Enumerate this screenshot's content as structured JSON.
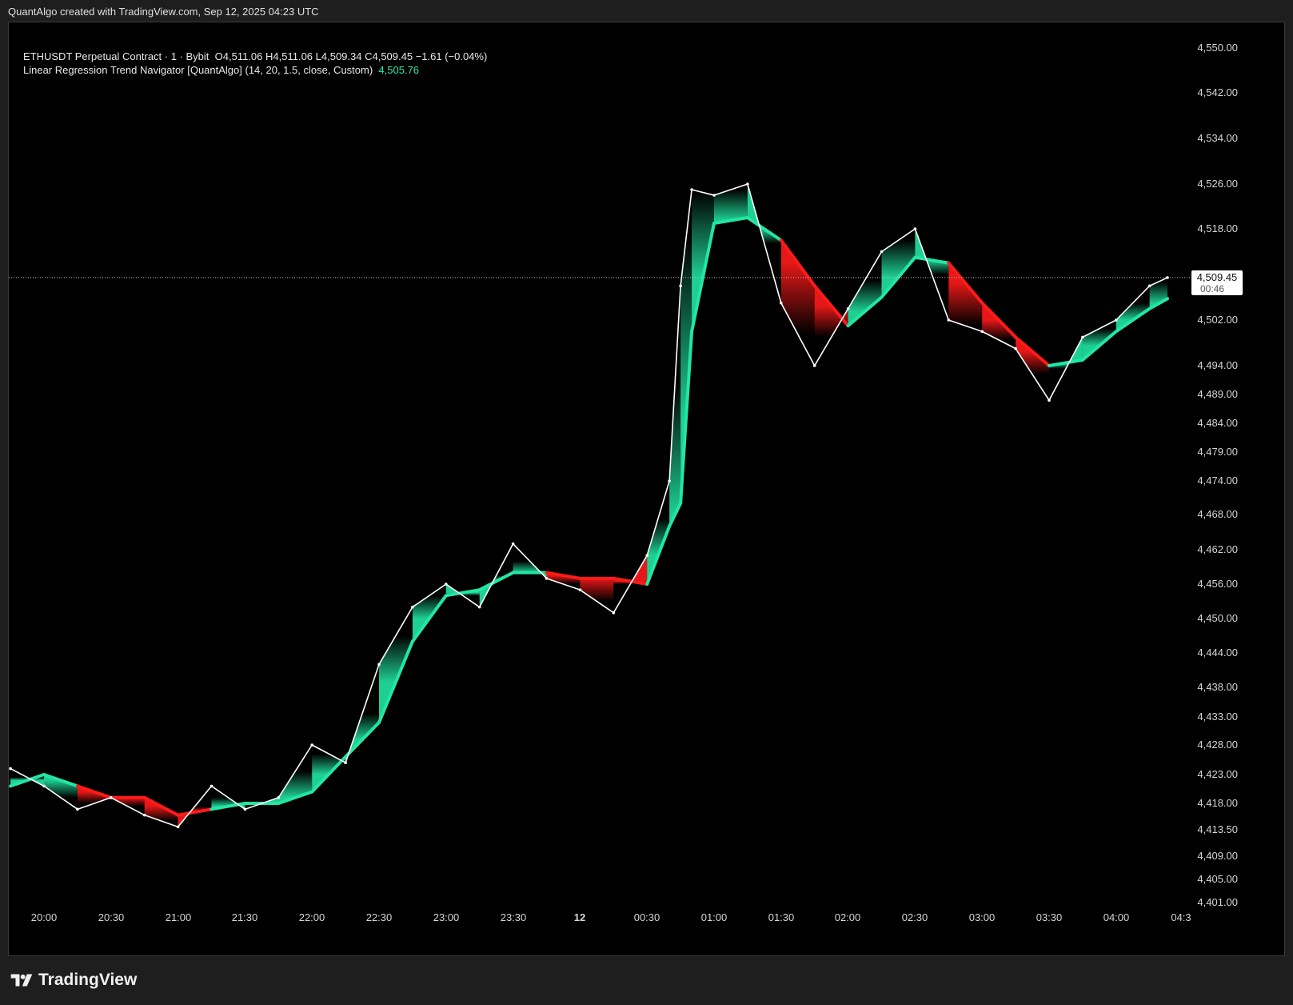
{
  "header": {
    "credit": "QuantAlgo created with TradingView.com, Sep 12, 2025 04:23 UTC"
  },
  "legend": {
    "symbol": "ETHUSDT Perpetual Contract · 1 · Bybit",
    "ohlc": "O4,511.06  H4,511.06  L4,509.34  C4,509.45  −1.61 (−0.04%)",
    "indicator": "Linear Regression Trend Navigator [QuantAlgo] (14, 20, 1.5, close, Custom)",
    "indicator_value": "4,505.76"
  },
  "price_tag": {
    "price": "4,509.45",
    "countdown": "00:46"
  },
  "brand": {
    "name": "TradingView",
    "icon": "tradingview-logo-icon"
  },
  "colors": {
    "bull": "#22e6a3",
    "bear": "#ff1a1a",
    "candle": "#ffffff",
    "background": "#000000"
  },
  "chart_data": {
    "type": "line",
    "title": "ETHUSDT Perpetual Contract · 1 · Bybit",
    "y_ticks": [
      "4,550.00",
      "4,542.00",
      "4,534.00",
      "4,526.00",
      "4,518.00",
      "4,502.00",
      "4,494.00",
      "4,489.00",
      "4,484.00",
      "4,479.00",
      "4,474.00",
      "4,468.00",
      "4,462.00",
      "4,456.00",
      "4,450.00",
      "4,444.00",
      "4,438.00",
      "4,433.00",
      "4,428.00",
      "4,423.00",
      "4,418.00",
      "4,413.50",
      "4,409.00",
      "4,405.00",
      "4,401.00"
    ],
    "x_ticks": [
      "20:00",
      "20:30",
      "21:00",
      "21:30",
      "22:00",
      "22:30",
      "23:00",
      "23:30",
      "12",
      "00:30",
      "01:00",
      "01:30",
      "02:00",
      "02:30",
      "03:00",
      "03:30",
      "04:00",
      "04:3"
    ],
    "ylim": [
      4401,
      4550
    ],
    "series": [
      {
        "kind": "price",
        "x": [
          "19:45",
          "20:00",
          "20:15",
          "20:30",
          "20:45",
          "21:00",
          "21:15",
          "21:30",
          "21:45",
          "22:00",
          "22:15",
          "22:30",
          "22:45",
          "23:00",
          "23:15",
          "23:30",
          "23:45",
          "00:00",
          "00:15",
          "00:30",
          "00:40",
          "00:45",
          "00:50",
          "01:00",
          "01:15",
          "01:30",
          "01:45",
          "02:00",
          "02:15",
          "02:30",
          "02:45",
          "03:00",
          "03:15",
          "03:30",
          "03:45",
          "04:00",
          "04:15",
          "04:23"
        ],
        "values": [
          4424,
          4421,
          4417,
          4419,
          4416,
          4414,
          4421,
          4417,
          4419,
          4428,
          4425,
          4442,
          4452,
          4456,
          4452,
          4463,
          4457,
          4455,
          4451,
          4461,
          4474,
          4508,
          4525,
          4524,
          4526,
          4505,
          4494,
          4504,
          4514,
          4518,
          4502,
          4500,
          4497,
          4488,
          4499,
          4502,
          4508,
          4509.45
        ]
      },
      {
        "kind": "indicator",
        "x": [
          "19:45",
          "20:00",
          "20:15",
          "20:30",
          "20:45",
          "21:00",
          "21:15",
          "21:30",
          "21:45",
          "22:00",
          "22:15",
          "22:30",
          "22:45",
          "23:00",
          "23:15",
          "23:30",
          "23:45",
          "00:00",
          "00:15",
          "00:30",
          "00:40",
          "00:45",
          "00:50",
          "01:00",
          "01:15",
          "01:30",
          "01:45",
          "02:00",
          "02:15",
          "02:30",
          "02:45",
          "03:00",
          "03:15",
          "03:30",
          "03:45",
          "04:00",
          "04:15",
          "04:23"
        ],
        "values": [
          4421,
          4423,
          4421,
          4419,
          4419,
          4416,
          4417,
          4418,
          4418,
          4420,
          4426,
          4432,
          4446,
          4454,
          4455,
          4458,
          4458,
          4457,
          4457,
          4456,
          4466,
          4470,
          4500,
          4519,
          4520,
          4516,
          4508,
          4501,
          4506,
          4513,
          4512,
          4505,
          4499,
          4494,
          4495,
          4500,
          4504,
          4505.76
        ],
        "trend": [
          "up",
          "up",
          "down",
          "down",
          "down",
          "down",
          "up",
          "up",
          "up",
          "up",
          "up",
          "up",
          "up",
          "up",
          "up",
          "up",
          "down",
          "down",
          "down",
          "up",
          "up",
          "up",
          "up",
          "up",
          "up",
          "down",
          "down",
          "up",
          "up",
          "up",
          "down",
          "down",
          "down",
          "up",
          "up",
          "up",
          "up",
          "up"
        ]
      }
    ]
  }
}
